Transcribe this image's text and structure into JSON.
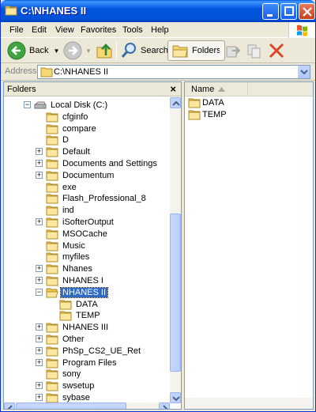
{
  "window": {
    "title": "C:\\NHANES II"
  },
  "menu": {
    "items": [
      "File",
      "Edit",
      "View",
      "Favorites",
      "Tools",
      "Help"
    ]
  },
  "toolbar": {
    "back_label": "Back",
    "search_label": "Search",
    "folders_label": "Folders"
  },
  "address": {
    "label": "Address",
    "value": "C:\\NHANES II"
  },
  "folders_pane": {
    "title": "Folders",
    "tree": [
      {
        "label": "Local Disk (C:)",
        "level": 0,
        "expander": "minus",
        "icon": "drive-icon"
      },
      {
        "label": "cfginfo",
        "level": 1,
        "expander": "none",
        "icon": "folder-icon"
      },
      {
        "label": "compare",
        "level": 1,
        "expander": "none",
        "icon": "folder-icon"
      },
      {
        "label": "D",
        "level": 1,
        "expander": "none",
        "icon": "folder-icon"
      },
      {
        "label": "Default",
        "level": 1,
        "expander": "plus",
        "icon": "folder-icon"
      },
      {
        "label": "Documents and Settings",
        "level": 1,
        "expander": "plus",
        "icon": "folder-icon"
      },
      {
        "label": "Documentum",
        "level": 1,
        "expander": "plus",
        "icon": "folder-icon"
      },
      {
        "label": "exe",
        "level": 1,
        "expander": "none",
        "icon": "folder-icon"
      },
      {
        "label": "Flash_Professional_8",
        "level": 1,
        "expander": "none",
        "icon": "folder-icon"
      },
      {
        "label": "ind",
        "level": 1,
        "expander": "none",
        "icon": "folder-icon"
      },
      {
        "label": "iSofterOutput",
        "level": 1,
        "expander": "plus",
        "icon": "folder-icon"
      },
      {
        "label": "MSOCache",
        "level": 1,
        "expander": "none",
        "icon": "folder-icon"
      },
      {
        "label": "Music",
        "level": 1,
        "expander": "none",
        "icon": "folder-icon"
      },
      {
        "label": "myfiles",
        "level": 1,
        "expander": "none",
        "icon": "folder-icon"
      },
      {
        "label": "Nhanes",
        "level": 1,
        "expander": "plus",
        "icon": "folder-icon"
      },
      {
        "label": "NHANES I",
        "level": 1,
        "expander": "plus",
        "icon": "folder-icon"
      },
      {
        "label": "NHANES II",
        "level": 1,
        "expander": "minus",
        "icon": "folder-open-icon",
        "selected": true
      },
      {
        "label": "DATA",
        "level": 2,
        "expander": "none",
        "icon": "folder-icon"
      },
      {
        "label": "TEMP",
        "level": 2,
        "expander": "none",
        "icon": "folder-icon"
      },
      {
        "label": "NHANES III",
        "level": 1,
        "expander": "plus",
        "icon": "folder-icon"
      },
      {
        "label": "Other",
        "level": 1,
        "expander": "plus",
        "icon": "folder-icon"
      },
      {
        "label": "PhSp_CS2_UE_Ret",
        "level": 1,
        "expander": "plus",
        "icon": "folder-icon"
      },
      {
        "label": "Program Files",
        "level": 1,
        "expander": "plus",
        "icon": "folder-icon"
      },
      {
        "label": "sony",
        "level": 1,
        "expander": "none",
        "icon": "folder-icon"
      },
      {
        "label": "swsetup",
        "level": 1,
        "expander": "plus",
        "icon": "folder-icon"
      },
      {
        "label": "sybase",
        "level": 1,
        "expander": "plus",
        "icon": "folder-icon"
      }
    ]
  },
  "list_pane": {
    "column_name": "Name",
    "items": [
      {
        "label": "DATA",
        "icon": "folder-icon"
      },
      {
        "label": "TEMP",
        "icon": "folder-icon"
      }
    ]
  },
  "colors": {
    "title_bar": "#0256E0",
    "selection": "#316AC5",
    "folder": "#F8D775"
  }
}
